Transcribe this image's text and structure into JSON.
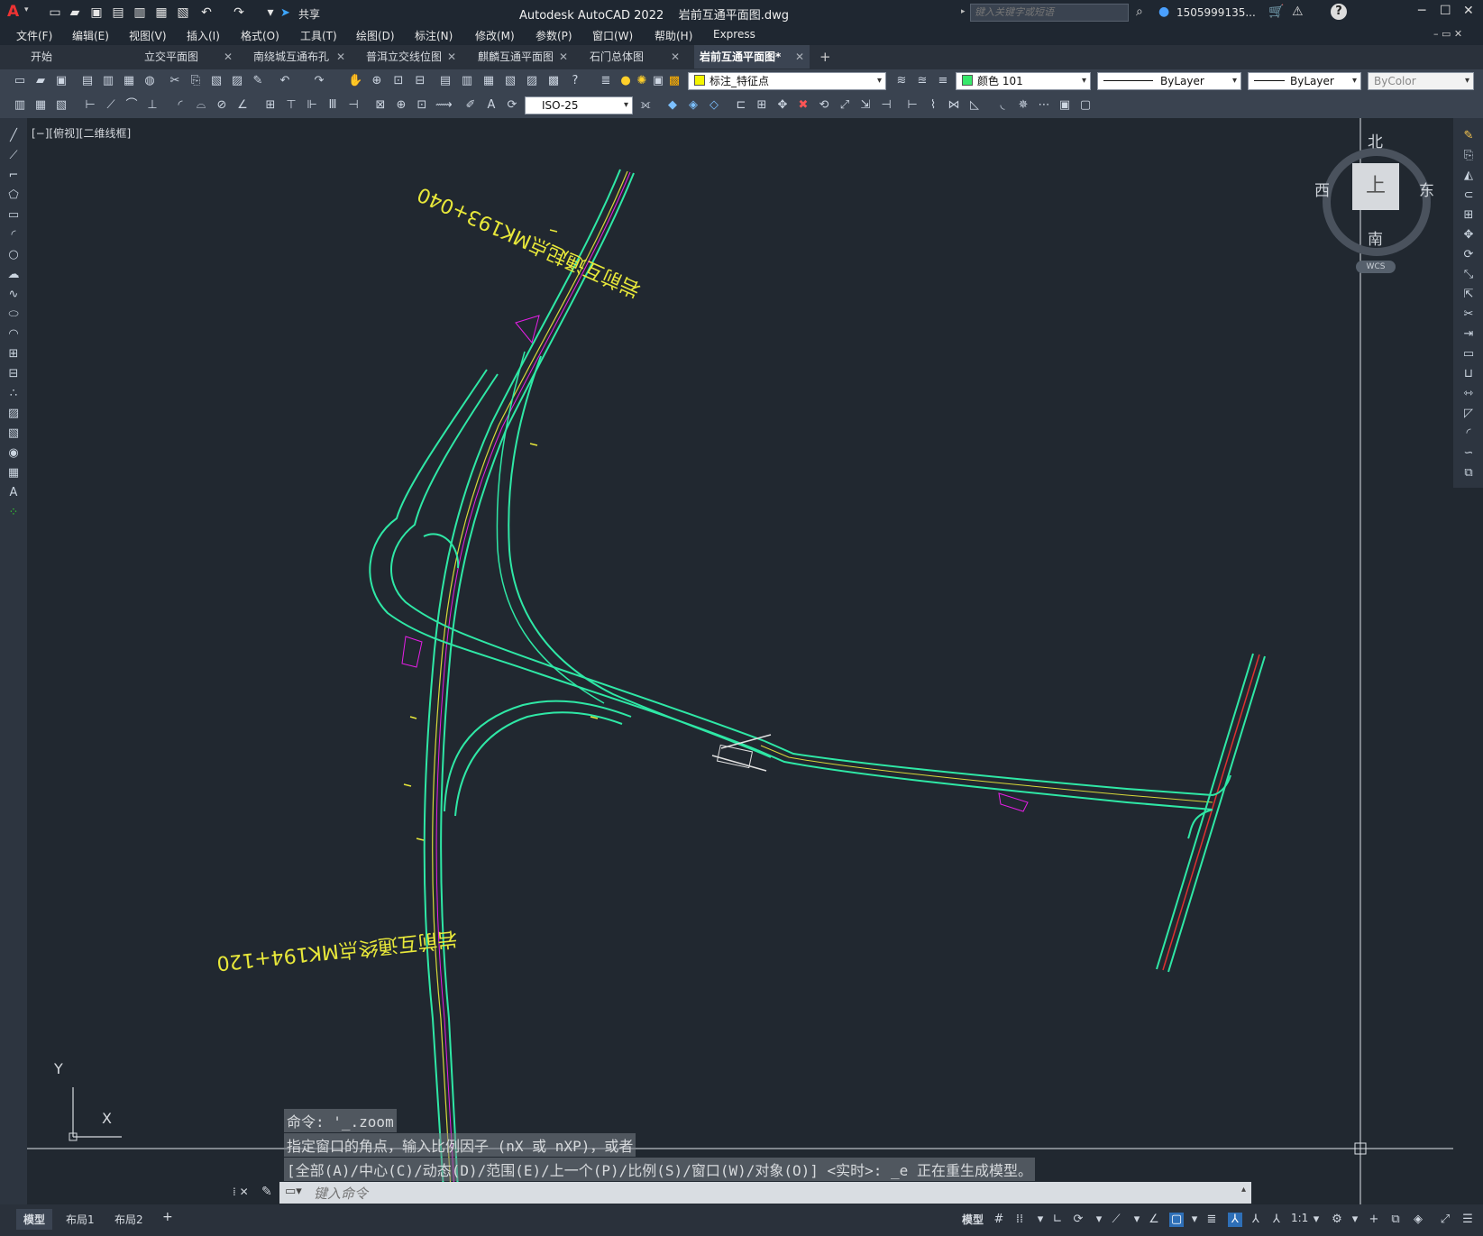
{
  "titlebar": {
    "app_logo": "A",
    "share_label": "共享",
    "title": "Autodesk AutoCAD 2022    岩前互通平面图.dwg",
    "search_placeholder": "键入关键字或短语",
    "user": "1505999135...",
    "min": "─",
    "max": "☐",
    "close": "✕"
  },
  "menubar": [
    "文件(F)",
    "编辑(E)",
    "视图(V)",
    "插入(I)",
    "格式(O)",
    "工具(T)",
    "绘图(D)",
    "标注(N)",
    "修改(M)",
    "参数(P)",
    "窗口(W)",
    "帮助(H)",
    "Express"
  ],
  "tabs": [
    {
      "label": "开始",
      "closable": false
    },
    {
      "label": "立交平面图",
      "closable": true
    },
    {
      "label": "南绕城互通布孔",
      "closable": true
    },
    {
      "label": "普洱立交线位图",
      "closable": true
    },
    {
      "label": "麒麟互通平面图",
      "closable": true
    },
    {
      "label": "石门总体图",
      "closable": true
    },
    {
      "label": "岩前互通平面图*",
      "closable": true,
      "active": true
    }
  ],
  "tab_add": "+",
  "toolbar": {
    "layer": "标注_特征点",
    "color": "颜色 101",
    "linetype": "ByLayer",
    "lineweight": "ByLayer",
    "plotstyle": "ByColor",
    "dimstyle": "ISO-25"
  },
  "viewport": {
    "label": "[−][俯视][二维线框]",
    "viewcube": {
      "north": "北",
      "south": "南",
      "east": "东",
      "west": "西",
      "top": "上",
      "wcs": "WCS"
    },
    "annotations": {
      "start": "岩前互通起点MK193+040",
      "end": "岩前互通终点MK194+120"
    },
    "ucs": {
      "x": "X",
      "y": "Y"
    }
  },
  "command": {
    "history": [
      "命令: '_.zoom",
      "指定窗口的角点，输入比例因子 (nX 或 nXP)，或者",
      "[全部(A)/中心(C)/动态(D)/范围(E)/上一个(P)/比例(S)/窗口(W)/对象(O)] <实时>: _e 正在重生成模型。"
    ],
    "placeholder": "键入命令"
  },
  "status": {
    "layout_tabs": [
      "模型",
      "布局1",
      "布局2"
    ],
    "add": "+",
    "model": "模型",
    "scale": "1:1"
  },
  "colors": {
    "background": "#212830",
    "road_edge": "#2fe8a6",
    "centerline": "#d8d83a",
    "magenta": "#e61ee6",
    "red": "#e03030"
  }
}
